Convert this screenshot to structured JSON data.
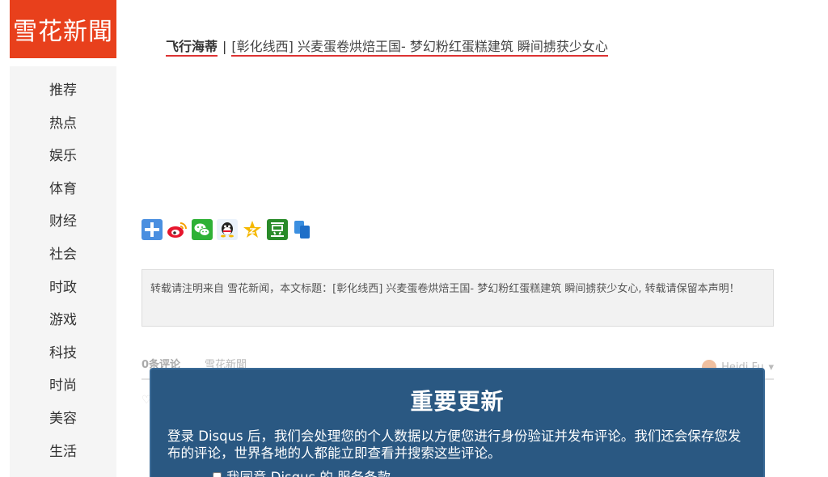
{
  "logo": {
    "text": "雪花新聞"
  },
  "sidebar": {
    "items": [
      {
        "label": "推荐"
      },
      {
        "label": "热点"
      },
      {
        "label": "娱乐"
      },
      {
        "label": "体育"
      },
      {
        "label": "财经"
      },
      {
        "label": "社会"
      },
      {
        "label": "时政"
      },
      {
        "label": "游戏"
      },
      {
        "label": "科技"
      },
      {
        "label": "时尚"
      },
      {
        "label": "美容"
      },
      {
        "label": "生活"
      }
    ]
  },
  "article": {
    "source": "飞行海蒂",
    "separator": "|",
    "headline": "[彰化线西] 兴麦蛋卷烘焙王国- 梦幻粉红蛋糕建筑 瞬间掳获少女心"
  },
  "share": {
    "icons": [
      "plus-icon",
      "weibo-icon",
      "wechat-icon",
      "qq-icon",
      "qzone-icon",
      "douban-icon",
      "copy-icon"
    ],
    "colors": {
      "plus": "#4a8fe0",
      "weibo": "#e6162d",
      "wechat": "#2eb135",
      "qq": "#333333",
      "qzone": "#f5b800",
      "douban": "#2a8b2a",
      "copy": "#3b8fe0"
    }
  },
  "notice": {
    "text": "转载请注明来自 雪花新闻，本文标题：[彰化线西] 兴麦蛋卷烘焙王国- 梦幻粉红蛋糕建筑 瞬间掳获少女心, 转载请保留本声明！"
  },
  "comments": {
    "count_label": "0条评论",
    "site_label": "雪花新聞",
    "user_name": "Heidi Fu"
  },
  "modal": {
    "title": "重要更新",
    "body": "登录 Disqus 后，我们会处理您的个人数据以方便您进行身份验证并发布评论。我们还会保存您发布的评论，世界各地的人都能立即查看并搜索这些评论。",
    "agree_label": "我同意 Disqus 的 服务条款"
  },
  "colors": {
    "brand": "#e8401c",
    "modal_bg": "#2a5882",
    "underline": "#dd3333"
  }
}
